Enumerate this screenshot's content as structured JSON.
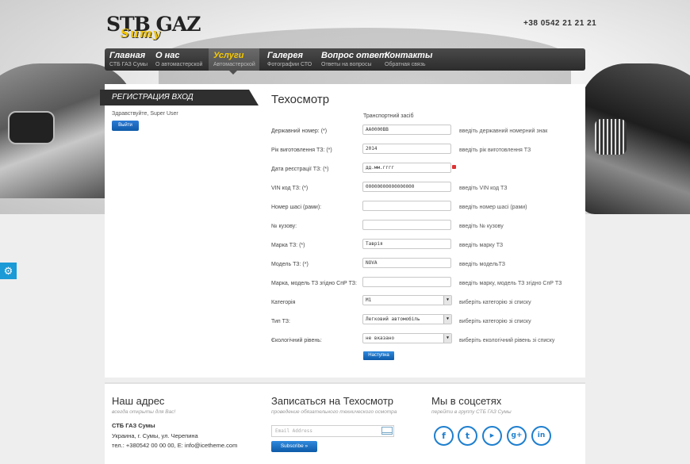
{
  "header": {
    "logo_main": "STB GAZ",
    "logo_sub": "Sumy",
    "phone": "+38 0542 21 21 21"
  },
  "nav": [
    {
      "title": "Главная",
      "subtitle": "СТБ ГАЗ Сумы"
    },
    {
      "title": "О нас",
      "subtitle": "О автомастерской"
    },
    {
      "title": "Услуги",
      "subtitle": "Автомастерской"
    },
    {
      "title": "Галерея",
      "subtitle": "Фотографии СТО"
    },
    {
      "title": "Вопрос ответ",
      "subtitle": "Ответы на вопросы"
    },
    {
      "title": "Контакты",
      "subtitle": "Обратная связь"
    }
  ],
  "sidebar": {
    "heading": "РЕГИСТРАЦИЯ ВХОД",
    "greeting": "Здравствуйте, Super User",
    "logout_label": "Выйти"
  },
  "form": {
    "title": "Техосмотр",
    "section": "Транспортний засіб",
    "rows": [
      {
        "label": "Державний номер: (*)",
        "value": "AA0000BB",
        "hint": "введіть державний номерний знак"
      },
      {
        "label": "Рік виготовлення ТЗ: (*)",
        "value": "2014",
        "hint": "введіть рік виготовлення ТЗ"
      },
      {
        "label": "Дата реєстрації ТЗ: (*)",
        "value": "дд.мм.гггг",
        "hint": ""
      },
      {
        "label": "VIN код ТЗ: (*)",
        "value": "00000000000000000",
        "hint": "введіть VIN код ТЗ"
      },
      {
        "label": "Номер шасі (рами):",
        "value": "",
        "hint": "введіть номер шасі (рами)"
      },
      {
        "label": "№ кузову:",
        "value": "",
        "hint": "введіть № кузову"
      },
      {
        "label": "Марка ТЗ: (*)",
        "value": "Таврія",
        "hint": "введіть марку ТЗ"
      },
      {
        "label": "Модель ТЗ: (*)",
        "value": "NOVA",
        "hint": "введіть модельТЗ"
      },
      {
        "label": "Марка, модель ТЗ згідно СпР ТЗ:",
        "value": "",
        "hint": "введіть марку, модель ТЗ згідно СпР ТЗ"
      }
    ],
    "selects": [
      {
        "label": "Категорія",
        "value": "M1",
        "hint": "виберіть категорію зі списку"
      },
      {
        "label": "Тип ТЗ:",
        "value": "Легковий автомобіль",
        "hint": "виберіть категорію зі списку"
      },
      {
        "label": "Єкологічний рівень:",
        "value": "не вказано",
        "hint": "виберіть екологічний рівень зі списку"
      }
    ],
    "submit_label": "Наступна"
  },
  "footer": {
    "address": {
      "title": "Наш адрес",
      "subtitle": "всегда открыты для Вас!",
      "company": "СТБ ГАЗ Сумы",
      "street": "Украина, г. Сумы, ул. Черепина",
      "contacts": "тел.: +380542 00 00 00, E: info@icetheme.com"
    },
    "signup": {
      "title": "Записаться на Техосмотр",
      "subtitle": "проведение обязательного технического осмотра",
      "email_placeholder": "Email Address",
      "subscribe_label": "Subscribe »"
    },
    "social": {
      "title": "Мы в соцсетях",
      "subtitle": "перейти в группу СТБ ГАЗ Сумы",
      "icons": [
        "facebook-icon",
        "twitter-icon",
        "youtube-icon",
        "google-plus-icon",
        "linkedin-icon"
      ]
    }
  }
}
